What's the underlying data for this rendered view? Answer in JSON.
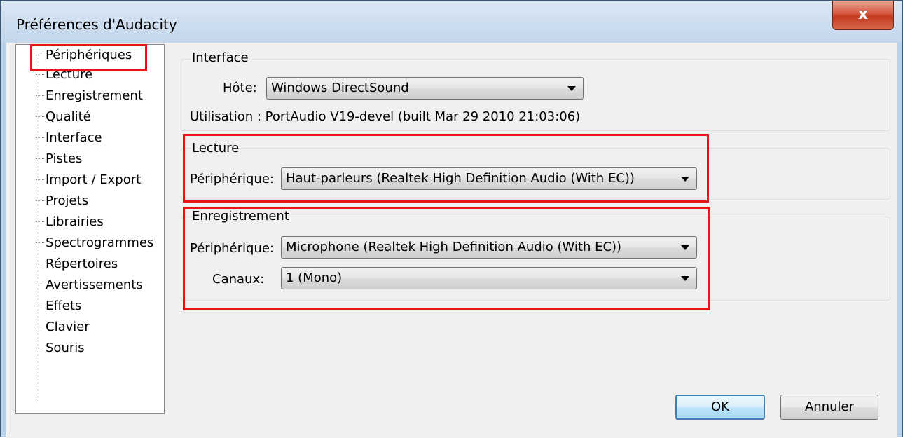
{
  "window": {
    "title": "Préférences d'Audacity",
    "close_glyph": "x"
  },
  "tree": {
    "items": [
      {
        "label": "Périphériques"
      },
      {
        "label": "Lecture"
      },
      {
        "label": "Enregistrement"
      },
      {
        "label": "Qualité"
      },
      {
        "label": "Interface"
      },
      {
        "label": "Pistes"
      },
      {
        "label": "Import / Export"
      },
      {
        "label": "Projets"
      },
      {
        "label": "Librairies"
      },
      {
        "label": "Spectrogrammes"
      },
      {
        "label": "Répertoires"
      },
      {
        "label": "Avertissements"
      },
      {
        "label": "Effets"
      },
      {
        "label": "Clavier"
      },
      {
        "label": "Souris"
      }
    ],
    "selected": "Périphériques"
  },
  "interface_group": {
    "title": "Interface",
    "host_label": "Hôte:",
    "host_value": "Windows DirectSound",
    "usage_text": "Utilisation : PortAudio V19-devel (built Mar 29 2010 21:03:06)"
  },
  "playback_group": {
    "title": "Lecture",
    "device_label": "Périphérique:",
    "device_value": "Haut-parleurs (Realtek High Definition Audio (With EC))"
  },
  "recording_group": {
    "title": "Enregistrement",
    "device_label": "Périphérique:",
    "device_value": "Microphone (Realtek High Definition Audio (With EC))",
    "channels_label": "Canaux:",
    "channels_value": "1 (Mono)"
  },
  "buttons": {
    "ok": "OK",
    "cancel": "Annuler"
  },
  "colors": {
    "highlight": "#e8141a",
    "close_button": "#c23a20"
  }
}
